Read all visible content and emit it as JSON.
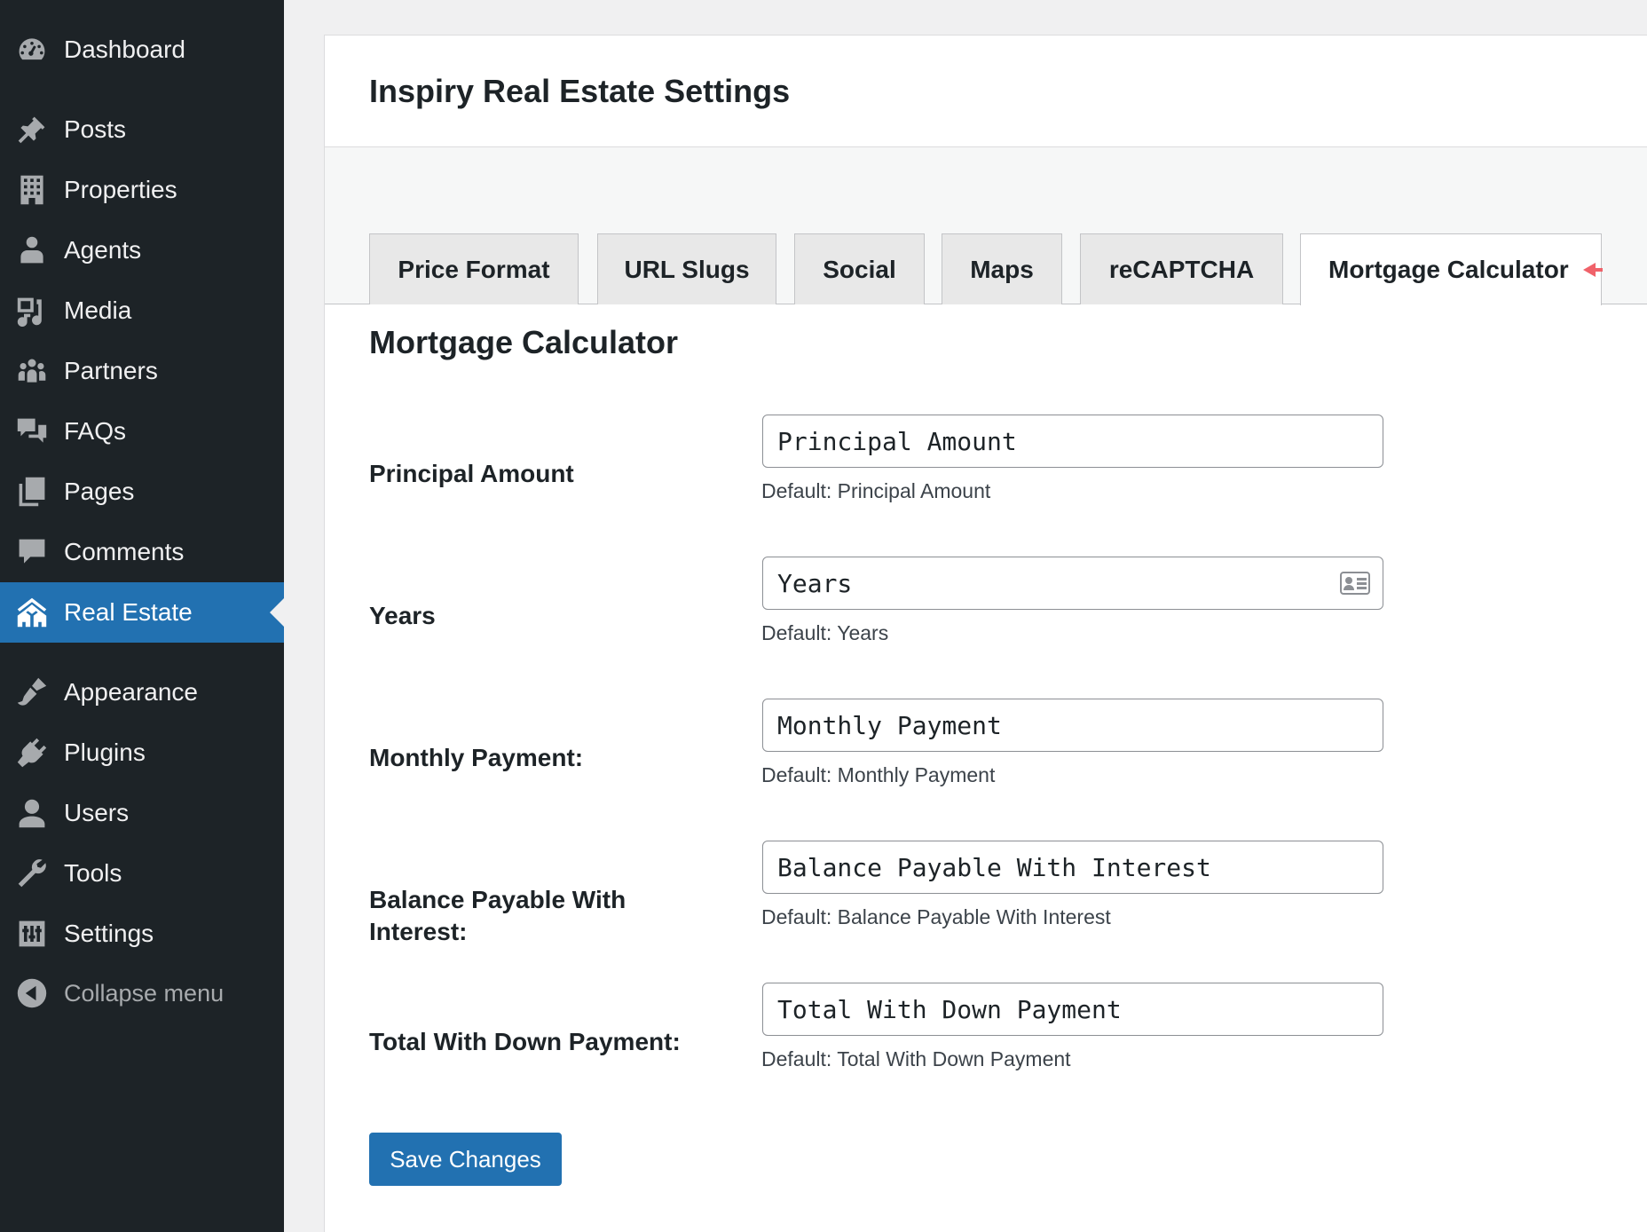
{
  "sidebar": {
    "items": [
      {
        "label": "Dashboard",
        "icon": "dashboard-icon"
      },
      {
        "label": "Posts",
        "icon": "pin-icon"
      },
      {
        "label": "Properties",
        "icon": "building-icon"
      },
      {
        "label": "Agents",
        "icon": "person-icon"
      },
      {
        "label": "Media",
        "icon": "media-icon"
      },
      {
        "label": "Partners",
        "icon": "groups-icon"
      },
      {
        "label": "FAQs",
        "icon": "chat-bubbles-icon"
      },
      {
        "label": "Pages",
        "icon": "pages-icon"
      },
      {
        "label": "Comments",
        "icon": "comment-icon"
      },
      {
        "label": "Real Estate",
        "icon": "houses-icon",
        "active": true
      },
      {
        "label": "Appearance",
        "icon": "brush-icon"
      },
      {
        "label": "Plugins",
        "icon": "plug-icon"
      },
      {
        "label": "Users",
        "icon": "user-icon"
      },
      {
        "label": "Tools",
        "icon": "wrench-icon"
      },
      {
        "label": "Settings",
        "icon": "sliders-icon"
      }
    ],
    "collapse_label": "Collapse menu"
  },
  "page": {
    "title": "Inspiry Real Estate Settings"
  },
  "tabs": [
    {
      "label": "Price Format"
    },
    {
      "label": "URL Slugs"
    },
    {
      "label": "Social"
    },
    {
      "label": "Maps"
    },
    {
      "label": "reCAPTCHA"
    },
    {
      "label": "Mortgage Calculator",
      "active": true
    }
  ],
  "section": {
    "title": "Mortgage Calculator"
  },
  "fields": [
    {
      "label": "Principal Amount",
      "placeholder": "Principal Amount",
      "description": "Default: Principal Amount"
    },
    {
      "label": "Years",
      "placeholder": "Years",
      "description": "Default: Years"
    },
    {
      "label": "Monthly Payment:",
      "placeholder": "Monthly Payment",
      "description": "Default: Monthly Payment"
    },
    {
      "label": "Balance Payable With Interest:",
      "placeholder": "Balance Payable With Interest",
      "description": "Default: Balance Payable With Interest"
    },
    {
      "label": "Total With Down Payment:",
      "placeholder": "Total With Down Payment",
      "description": "Default: Total With Down Payment"
    }
  ],
  "actions": {
    "save_label": "Save Changes"
  },
  "colors": {
    "sidebar_bg": "#1d2327",
    "accent": "#2271b1",
    "tab_pointer": "#f0626a"
  }
}
